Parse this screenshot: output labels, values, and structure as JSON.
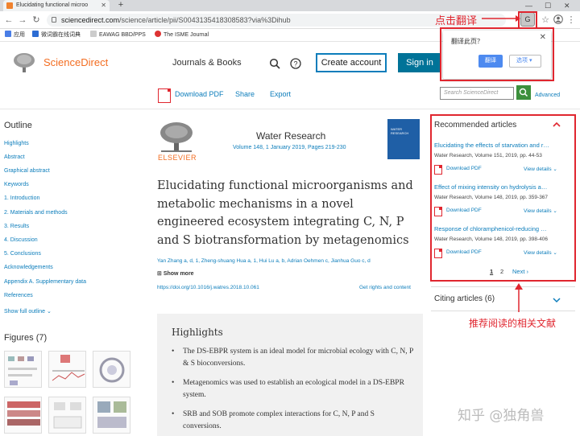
{
  "browser": {
    "tab_title": "Elucidating functional microo",
    "url_host": "sciencedirect.com",
    "url_path": "/science/article/pii/S0043135418308583?via%3Dihub",
    "bookmarks": [
      "应用",
      "微词霸在线词典",
      "EAWAG BBD/PPS",
      "The ISME Journal"
    ]
  },
  "annotations": {
    "translate_hint": "点击翻译",
    "recommended_hint": "推荐阅读的相关文献",
    "watermark": "知乎 @独角兽"
  },
  "translate_popup": {
    "question": "翻译此页？",
    "translate_btn": "翻译",
    "options_btn": "选项"
  },
  "header": {
    "logo": "ScienceDirect",
    "journals_books": "Journals & Books",
    "create_account": "Create account",
    "sign_in": "Sign in",
    "download_pdf": "Download PDF",
    "share": "Share",
    "export": "Export",
    "search_placeholder": "Search ScienceDirect",
    "advanced": "Advanced"
  },
  "outline": {
    "title": "Outline",
    "items": [
      "Highlights",
      "Abstract",
      "Graphical abstract",
      "Keywords",
      "1. Introduction",
      "2. Materials and methods",
      "3. Results",
      "4. Discussion",
      "5. Conclusions",
      "Acknowledgements",
      "Appendix A. Supplementary data",
      "References"
    ],
    "show_full": "Show full outline",
    "figures": "Figures (7)"
  },
  "article": {
    "publisher": "ELSEVIER",
    "journal": "Water Research",
    "volume": "Volume 148, 1 January 2019, Pages 219-230",
    "cover_text": "WATER RESEARCH",
    "title": "Elucidating functional microorganisms and metabolic mechanisms in a novel engineered ecosystem integrating C, N, P and S biotransformation by metagenomics",
    "authors": "Yan Zhang a, d, 1, Zheng-shuang Hua a, 1, Hui Lu a, b, Adrian Oehmen c, Jianhua Guo c, d",
    "show_more": "Show more",
    "doi": "https://doi.org/10.1016/j.watres.2018.10.061",
    "rights": "Get rights and content",
    "highlights_title": "Highlights",
    "highlights": [
      "The DS-EBPR system is an ideal model for microbial ecology with C, N, P & S bioconversions.",
      "Metagenomics was used to establish an ecological model in a DS-EBPR system.",
      "SRB and SOB promote complex interactions for C, N, P and S conversions."
    ]
  },
  "recommended": {
    "title": "Recommended articles",
    "items": [
      {
        "title": "Elucidating the effects of starvation and r…",
        "meta": "Water Research, Volume 151, 2019, pp. 44-53"
      },
      {
        "title": "Effect of mixing intensity on hydrolysis a…",
        "meta": "Water Research, Volume 148, 2019, pp. 359-367"
      },
      {
        "title": "Response of chloramphenicol-reducing …",
        "meta": "Water Research, Volume 148, 2019, pp. 398-406"
      }
    ],
    "download_pdf": "Download PDF",
    "view_details": "View details",
    "page1": "1",
    "page2": "2",
    "next": "Next",
    "citing": "Citing articles (6)"
  }
}
